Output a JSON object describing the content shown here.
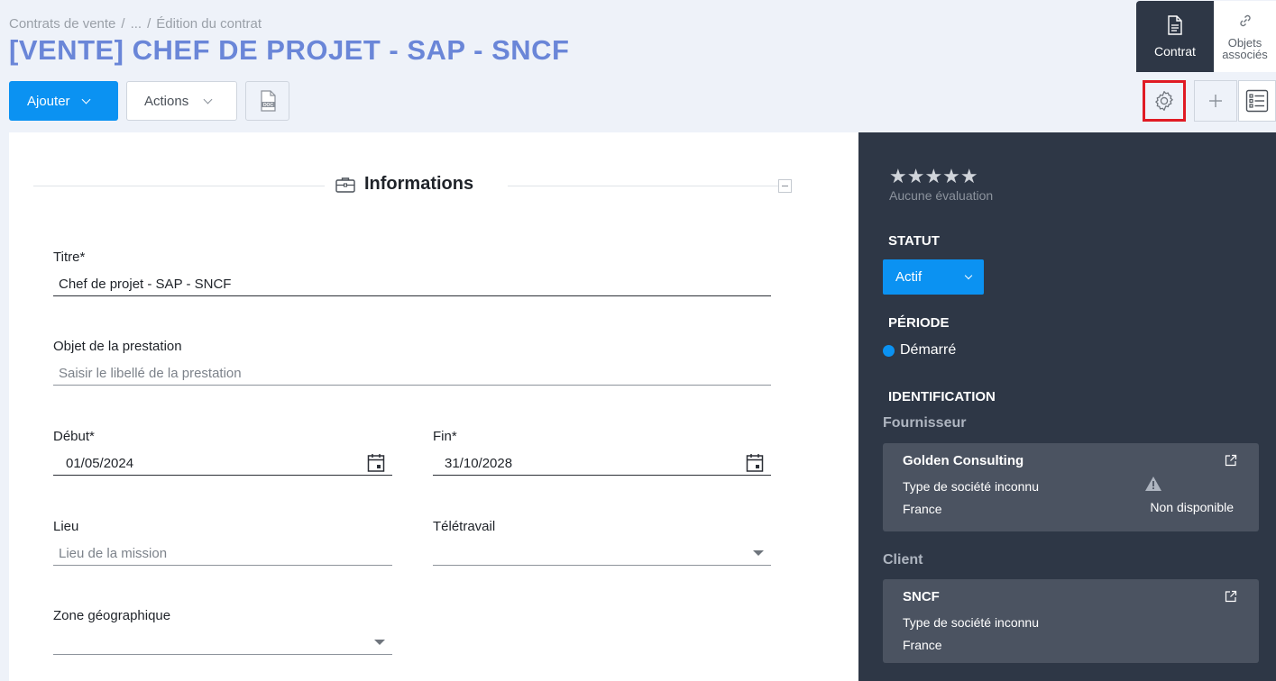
{
  "header": {
    "breadcrumb": [
      "Contrats de vente",
      "...",
      "Édition du contrat"
    ],
    "breadcrumb_sep": "/",
    "title": "[VENTE] CHEF DE PROJET - SAP - SNCF"
  },
  "toolbar": {
    "add_label": "Ajouter",
    "actions_label": "Actions",
    "doc_label": "DOC"
  },
  "tabs": {
    "contrat": "Contrat",
    "objets_line1": "Objets",
    "objets_line2": "associés"
  },
  "section": {
    "title": "Informations"
  },
  "form": {
    "titre": {
      "label": "Titre*",
      "value": "Chef de projet - SAP - SNCF"
    },
    "objet": {
      "label": "Objet de la prestation",
      "placeholder": "Saisir le libellé de la prestation"
    },
    "debut": {
      "label": "Début*",
      "value": "01/05/2024"
    },
    "fin": {
      "label": "Fin*",
      "value": "31/10/2028"
    },
    "lieu": {
      "label": "Lieu",
      "placeholder": "Lieu de la mission"
    },
    "teletravail": {
      "label": "Télétravail",
      "value": ""
    },
    "zone": {
      "label": "Zone géographique",
      "value": ""
    }
  },
  "side": {
    "stars": "★★★★★",
    "rating_text": "Aucune évaluation",
    "statut_title": "STATUT",
    "statut_value": "Actif",
    "periode_title": "PÉRIODE",
    "periode_value": "Démarré",
    "identification_title": "IDENTIFICATION",
    "fournisseur_title": "Fournisseur",
    "fournisseur": {
      "name": "Golden Consulting",
      "type": "Type de société inconnu",
      "country": "France",
      "availability": "Non disponible"
    },
    "client_title": "Client",
    "client": {
      "name": "SNCF",
      "type": "Type de société inconnu",
      "country": "France"
    }
  },
  "colors": {
    "primary": "#0b92f2",
    "title": "#6a86d8",
    "sidebar": "#2e3746",
    "card": "#4b5361",
    "highlight": "#e01b24"
  }
}
